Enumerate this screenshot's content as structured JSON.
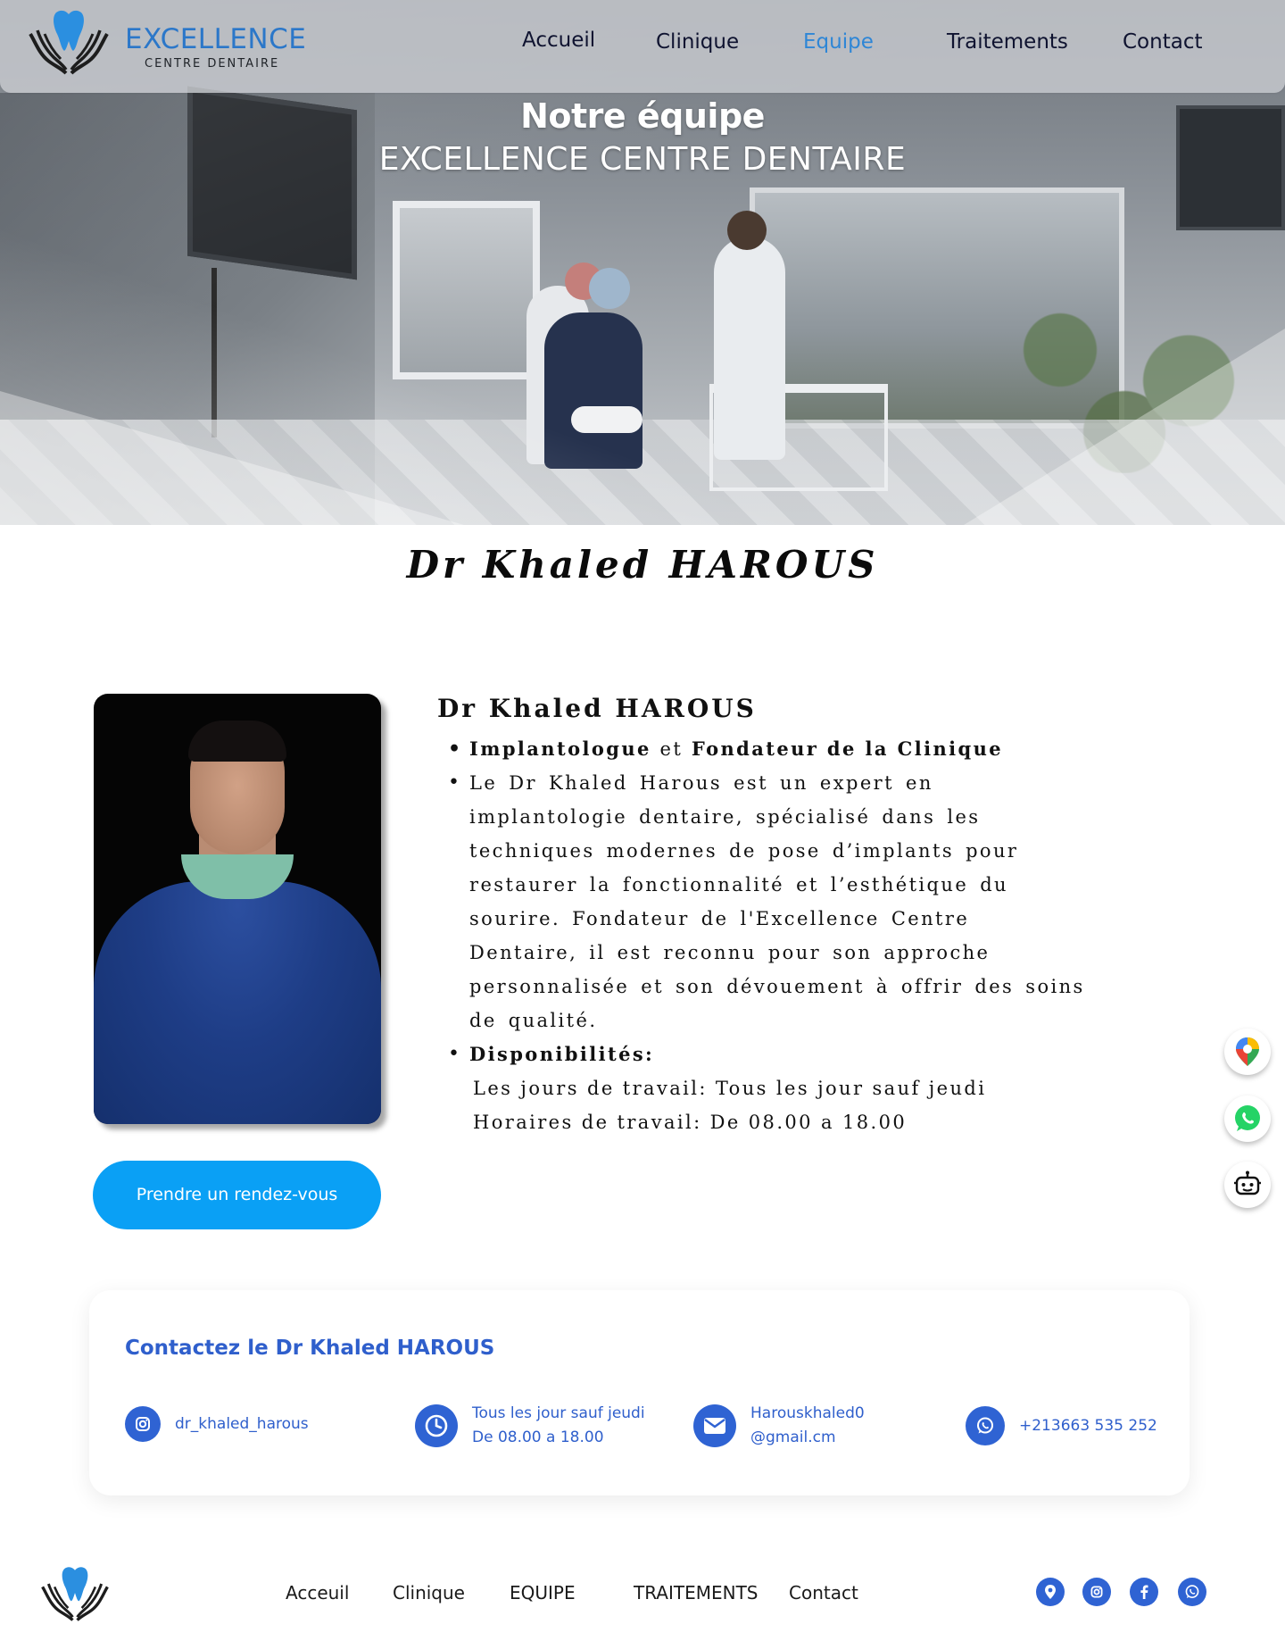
{
  "brand": {
    "name": "EXCELLENCE",
    "subtitle": "CENTRE DENTAIRE"
  },
  "nav": {
    "items": [
      "Accueil",
      "Clinique",
      "Equipe",
      "Traitements",
      "Contact"
    ],
    "active": "Equipe",
    "active_color": "#2e86d6"
  },
  "hero": {
    "title": "Notre équipe",
    "subtitle": "EXCELLENCE CENTRE DENTAIRE"
  },
  "doctor": {
    "page_title": "Dr Khaled HAROUS",
    "name": "Dr Khaled HAROUS",
    "role_part1": "Implantologue",
    "role_joiner": "et",
    "role_part2": "Fondateur de la Clinique",
    "description": "Le Dr Khaled Harous est un expert en implantologie dentaire, spécialisé dans les techniques modernes de pose d’implants pour restaurer la fonctionnalité et l’esthétique du sourire. Fondateur de l'Excellence Centre Dentaire, il est reconnu pour son approche personnalisée et son dévouement à offrir des soins de qualité.",
    "availability_title": "Disponibilités:",
    "work_days": "Les jours de travail: Tous les jour sauf jeudi",
    "work_hours": "Horaires de travail: De 08.00 a 18.00",
    "book_button": "Prendre un rendez-vous"
  },
  "floating": [
    "google-maps-icon",
    "whatsapp-icon",
    "chatbot-icon"
  ],
  "contact": {
    "title": "Contactez le Dr Khaled HAROUS",
    "instagram": "dr_khaled_harous",
    "schedule_line1": "Tous les jour sauf jeudi",
    "schedule_line2": "De 08.00 a 18.00",
    "email_line1": "Harouskhaled0",
    "email_line2": "@gmail.cm",
    "phone": "+213663 535 252",
    "accent": "#2f5fcc"
  },
  "footer": {
    "nav": [
      "Acceuil",
      "Clinique",
      "EQUIPE",
      "TRAITEMENTS",
      "Contact"
    ],
    "social": [
      "location-icon",
      "instagram-icon",
      "facebook-icon",
      "whatsapp-icon"
    ]
  },
  "colors": {
    "button": "#0aa0f5",
    "brand_blue": "#2b77c9"
  }
}
